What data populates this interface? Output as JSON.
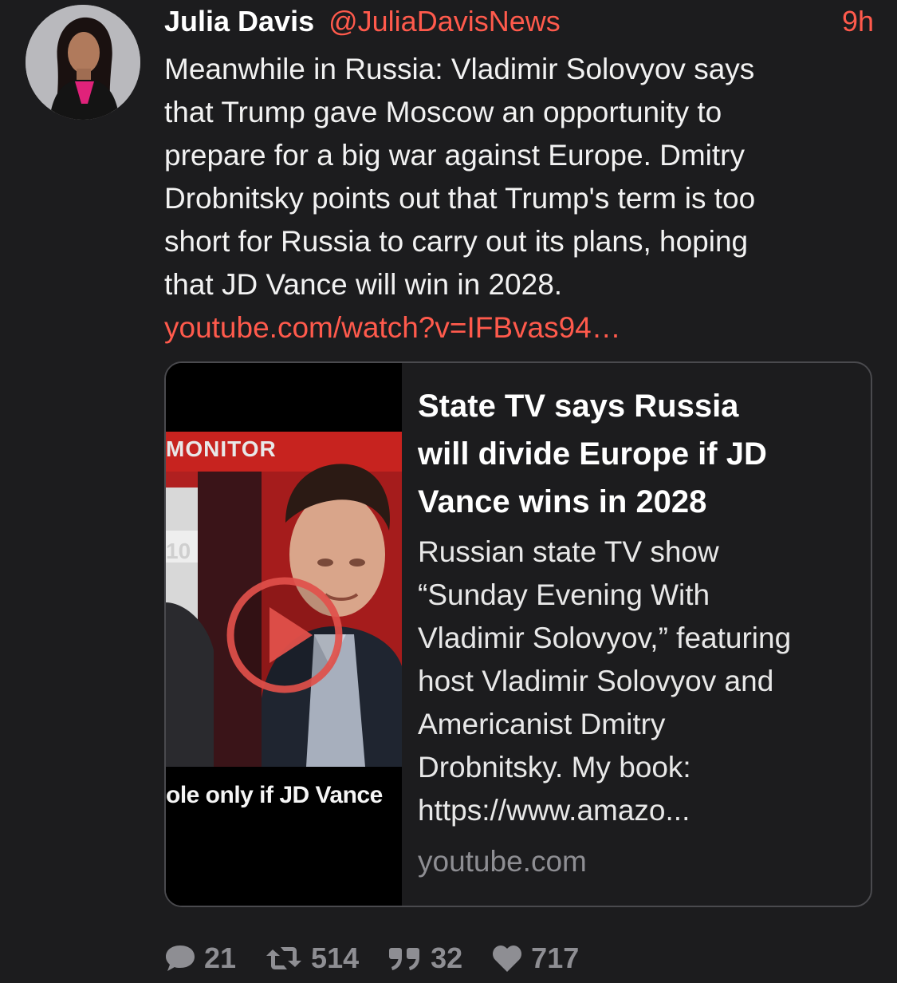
{
  "tweet": {
    "author_name": "Julia Davis",
    "author_handle": "@JuliaDavisNews",
    "time": "9h",
    "text": "Meanwhile in Russia: Vladimir Solovyov says\nthat Trump gave Moscow an opportunity to\nprepare for a big war against Europe. Dmitry\nDrobnitsky points out that Trump's term is too\nshort for Russia to carry out its plans, hoping\nthat JD Vance will win in 2028.",
    "link": "youtube.com/watch?v=IFBvas94…"
  },
  "card": {
    "title": "State TV says Russia\nwill divide Europe if JD\nVance wins in 2028",
    "description": "Russian state TV show\n“Sunday Evening With\nVladimir Solovyov,” featuring\nhost Vladimir Solovyov and\nAmericanist Dmitry\nDrobnitsky. My book:\nhttps://www.amazo...",
    "domain": "youtube.com",
    "thumbnail": {
      "monitor_label": "MONITOR",
      "side_number": "10",
      "caption": "ole only if JD Vance"
    }
  },
  "actions": {
    "replies": "21",
    "retweets": "514",
    "quotes": "32",
    "likes": "717"
  },
  "colors": {
    "background": "#1c1c1e",
    "accent": "#ff5a4c",
    "muted": "#8e8e93"
  },
  "icons": [
    "reply-icon",
    "retweet-icon",
    "quote-icon",
    "like-icon",
    "play-icon"
  ]
}
